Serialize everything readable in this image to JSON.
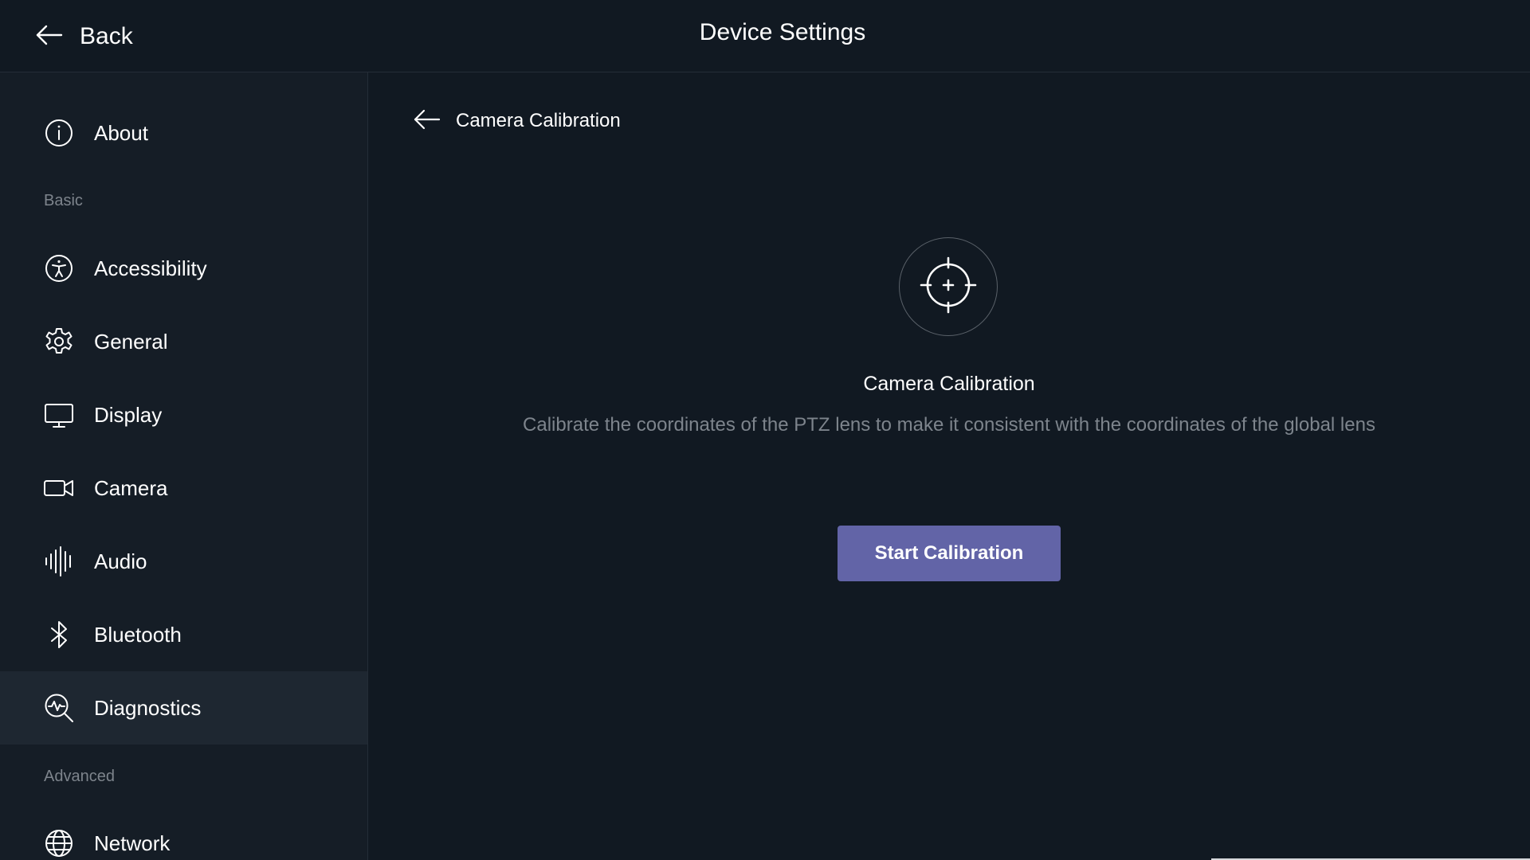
{
  "header": {
    "back_label": "Back",
    "title": "Device Settings"
  },
  "sidebar": {
    "about": {
      "label": "About",
      "icon": "info-icon"
    },
    "section_basic": "Basic",
    "items": [
      {
        "label": "Accessibility",
        "icon": "accessibility-icon"
      },
      {
        "label": "General",
        "icon": "gear-icon"
      },
      {
        "label": "Display",
        "icon": "monitor-icon"
      },
      {
        "label": "Camera",
        "icon": "video-camera-icon"
      },
      {
        "label": "Audio",
        "icon": "audio-wave-icon"
      },
      {
        "label": "Bluetooth",
        "icon": "bluetooth-icon"
      },
      {
        "label": "Diagnostics",
        "icon": "diagnostics-icon",
        "active": true
      }
    ],
    "section_advanced": "Advanced",
    "network": {
      "label": "Network",
      "icon": "globe-icon"
    }
  },
  "main": {
    "subheader_label": "Camera Calibration",
    "content_title": "Camera Calibration",
    "content_description": "Calibrate the coordinates of the PTZ lens to make it consistent with the coordinates of the global lens",
    "button_label": "Start Calibration",
    "icon": "crosshair-icon"
  },
  "colors": {
    "background": "#111922",
    "sidebar": "#151d26",
    "active_item": "#1e2731",
    "accent": "#6264a7",
    "muted_text": "#7d848c"
  }
}
